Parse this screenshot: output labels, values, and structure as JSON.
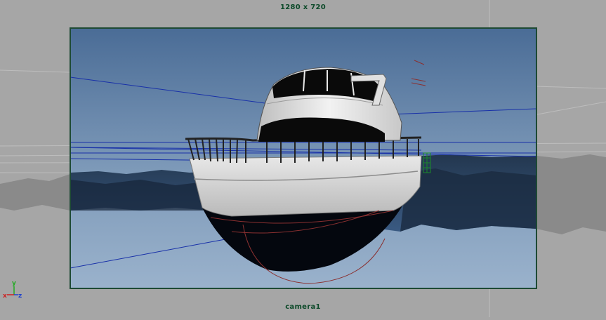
{
  "viewport": {
    "resolution": "1280 x 720",
    "camera": "camera1",
    "axis": {
      "x": "x",
      "y": "y",
      "z": "z"
    }
  },
  "colors": {
    "background": "#a6a6a6",
    "gate_border": "#1e4a34",
    "label": "#0d4a2a",
    "sky_top": "#4a6c96",
    "sky_bottom": "#8fa8c4",
    "water": "#1a2a40",
    "hull_dark": "#050810",
    "hull_white": "#d8d8d8"
  },
  "icons": [
    "axis-gizmo-icon",
    "light-icon"
  ]
}
